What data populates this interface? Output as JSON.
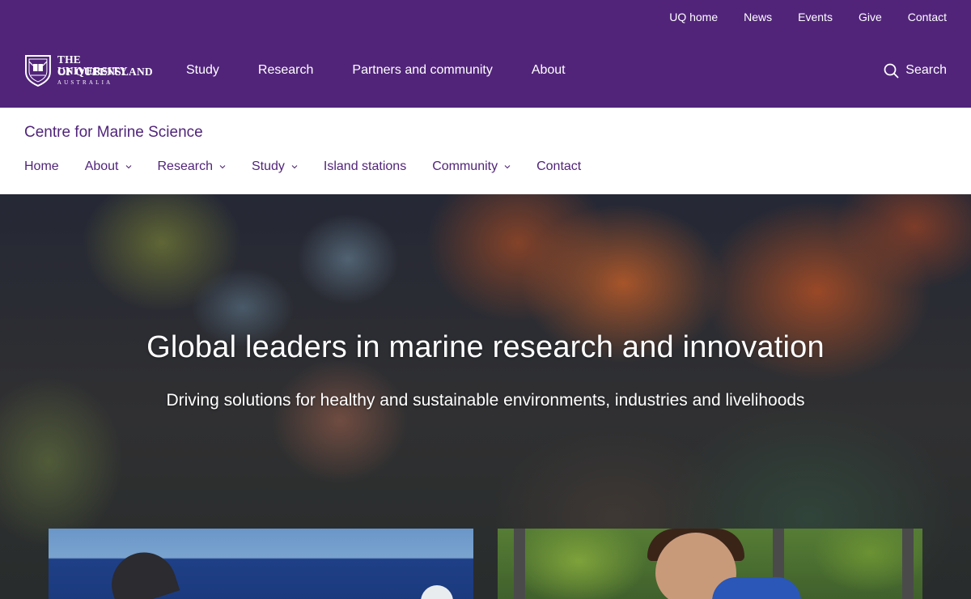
{
  "utility_nav": {
    "items": [
      {
        "label": "UQ home"
      },
      {
        "label": "News"
      },
      {
        "label": "Events"
      },
      {
        "label": "Give"
      },
      {
        "label": "Contact"
      }
    ]
  },
  "brand": {
    "line1": "The University",
    "line2": "of Queensland",
    "line3": "AUSTRALIA",
    "color": "#51247a"
  },
  "main_nav": {
    "items": [
      {
        "label": "Study"
      },
      {
        "label": "Research"
      },
      {
        "label": "Partners and community"
      },
      {
        "label": "About"
      }
    ],
    "search_label": "Search"
  },
  "site": {
    "title": "Centre for Marine Science",
    "nav": [
      {
        "label": "Home",
        "has_dropdown": false
      },
      {
        "label": "About",
        "has_dropdown": true
      },
      {
        "label": "Research",
        "has_dropdown": true
      },
      {
        "label": "Study",
        "has_dropdown": true
      },
      {
        "label": "Island stations",
        "has_dropdown": false
      },
      {
        "label": "Community",
        "has_dropdown": true
      },
      {
        "label": "Contact",
        "has_dropdown": false
      }
    ]
  },
  "hero": {
    "title": "Global leaders in marine research and innovation",
    "subtitle": "Driving solutions for healthy and sustainable environments, industries and livelihoods"
  }
}
